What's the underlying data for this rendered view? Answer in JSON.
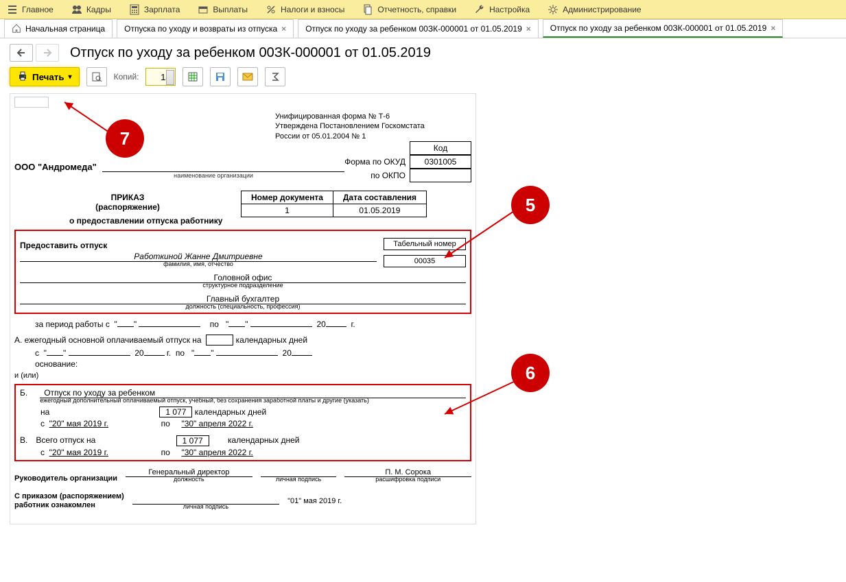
{
  "menu": {
    "main": "Главное",
    "hr": "Кадры",
    "salary": "Зарплата",
    "payments": "Выплаты",
    "taxes": "Налоги и взносы",
    "reports": "Отчетность, справки",
    "settings": "Настройка",
    "admin": "Администрирование"
  },
  "tabs": {
    "home": "Начальная страница",
    "list": "Отпуска по уходу и возвраты из отпуска",
    "doc1": "Отпуск по уходу за ребенком 00ЗК-000001 от 01.05.2019",
    "doc2": "Отпуск по уходу за ребенком 00ЗК-000001 от 01.05.2019"
  },
  "page": {
    "title": "Отпуск по уходу за ребенком 00ЗК-000001 от 01.05.2019"
  },
  "toolbar": {
    "print": "Печать",
    "copies_label": "Копий:",
    "copies_value": "1"
  },
  "form": {
    "header1": "Унифицированная форма № Т-6",
    "header2": "Утверждена Постановлением Госкомстата",
    "header3": "России от 05.01.2004 № 1",
    "code_label": "Код",
    "okud_label": "Форма по ОКУД",
    "okud_value": "0301005",
    "okpo_label": "по ОКПО",
    "org_name": "ООО \"Андромеда\"",
    "org_caption": "наименование организации",
    "docnum_header": "Номер документа",
    "docdate_header": "Дата составления",
    "docnum": "1",
    "docdate": "01.05.2019",
    "order_title": "ПРИКАЗ",
    "order_sub": "(распоряжение)",
    "order_about": "о предоставлении отпуска работнику",
    "grant_label": "Предоставить отпуск",
    "tabnum_header": "Табельный номер",
    "tabnum": "00035",
    "employee": "Работкиной Жанне Дмитриевне",
    "employee_caption": "фамилия, имя, отчество",
    "department": "Головной офис",
    "department_caption": "структурное подразделение",
    "position": "Главный бухгалтер",
    "position_caption": "должность (специальность, профессия)",
    "period_label": "за период работы с",
    "period_to": "по",
    "period_year_suffix": "20",
    "period_g": "г.",
    "sectionA_label": "А. ежегодный основной оплачиваемый отпуск на",
    "cal_days": "календарных дней",
    "from_s": "с",
    "to_po": "по",
    "basis_label": "основание:",
    "and_or": "и (или)",
    "sectionB_letter": "Б.",
    "sectionB_title": "Отпуск по уходу за ребенком",
    "sectionB_caption": "ежегодный дополнительный оплачиваемый отпуск, учебный, без сохранения заработной платы и другие (указать)",
    "b_on": "на",
    "b_days": "1 077",
    "b_from": "\"20\" мая 2019 г.",
    "b_to": "\"30\" апреля 2022 г.",
    "sectionV_letter": "В.",
    "sectionV_label": "Всего отпуск на",
    "v_days": "1 077",
    "v_from": "\"20\" мая 2019 г.",
    "v_to": "\"30\" апреля 2022 г.",
    "head_label": "Руководитель организации",
    "head_position": "Генеральный директор",
    "head_position_caption": "должность",
    "head_sign_caption": "личная подпись",
    "head_name": "П. М. Сорока",
    "head_name_caption": "расшифровка подписи",
    "ack_label1": "С приказом (распоряжением)",
    "ack_label2": "работник  ознакомлен",
    "ack_date": "\"01\" мая 2019 г.",
    "ack_sign_caption": "личная подпись"
  },
  "anno": {
    "n5": "5",
    "n6": "6",
    "n7": "7"
  }
}
